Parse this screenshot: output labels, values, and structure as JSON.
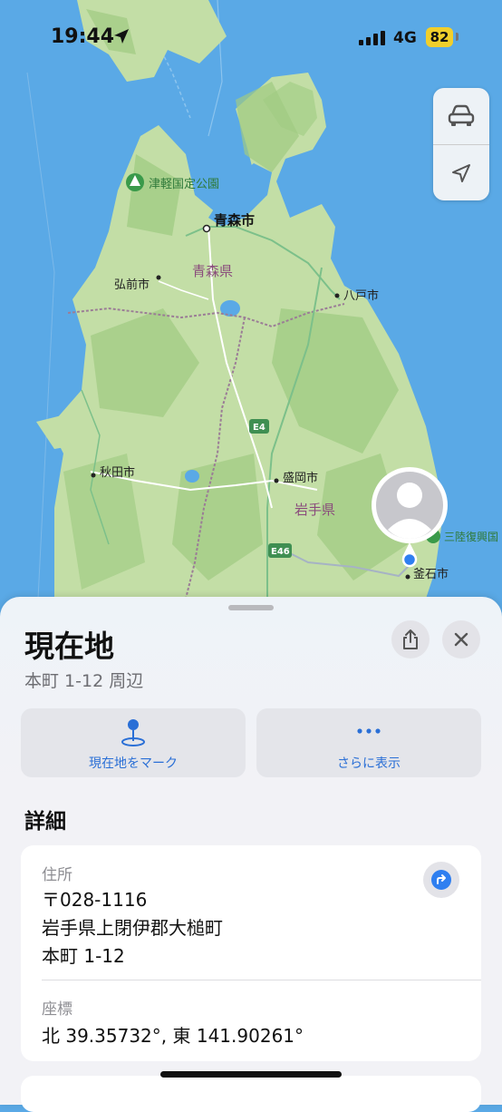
{
  "status": {
    "time": "19:44",
    "network": "4G",
    "battery": "82"
  },
  "map": {
    "colors": {
      "sea": "#5aa9e6",
      "land": "#c3dea6",
      "forest": "#9fcb82",
      "border": "#9b7d96",
      "road": "#ffffff",
      "highway": "#7cc08a"
    },
    "labels": {
      "park": "津軽国定公園",
      "aomori_city": "青森市",
      "hirosaki": "弘前市",
      "aomori_pref": "青森県",
      "hachinohe": "八戸市",
      "akita": "秋田市",
      "morioka": "盛岡市",
      "iwate_pref": "岩手県",
      "sanriku": "三陸復興国",
      "kamaishi": "釜石市",
      "e4": "E4",
      "e46": "E46"
    }
  },
  "sheet": {
    "title": "現在地",
    "subtitle": "本町 1-12 周辺",
    "actions": [
      {
        "label": "現在地をマーク",
        "icon": "pin-icon"
      },
      {
        "label": "さらに表示",
        "icon": "more-icon"
      }
    ],
    "details_header": "詳細",
    "address_label": "住所",
    "address_lines": [
      "〒028-1116",
      "岩手県上閉伊郡大槌町",
      "本町 1-12"
    ],
    "coord_label": "座標",
    "coord_value": "北 39.35732°, 東 141.90261°"
  }
}
